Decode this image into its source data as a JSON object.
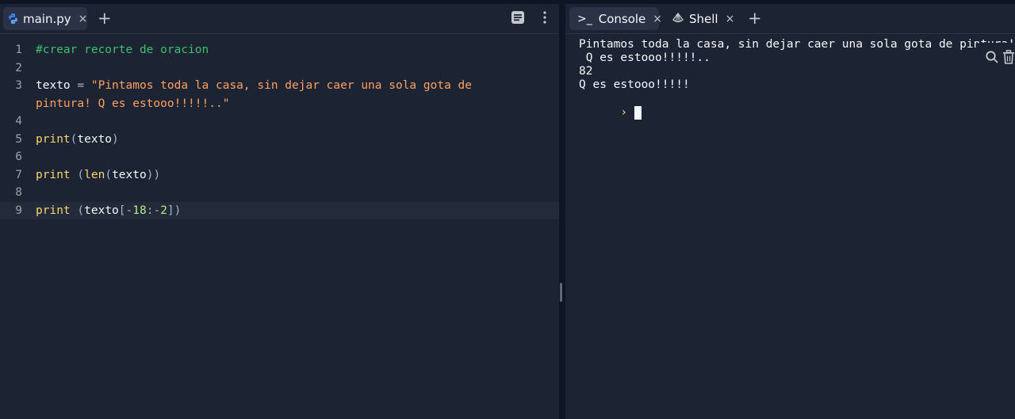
{
  "editor": {
    "tab": {
      "label": "main.py",
      "close": "×",
      "icon": "python-file-icon"
    },
    "new_tab": "+",
    "lines": [
      {
        "n": "1",
        "tokens": [
          {
            "t": "#crear recorte de oracion",
            "k": "comment"
          }
        ]
      },
      {
        "n": "2",
        "tokens": []
      },
      {
        "n": "3",
        "tokens": [
          {
            "t": "texto",
            "k": "ident"
          },
          {
            "t": " = ",
            "k": "op"
          },
          {
            "t": "\"Pintamos toda la casa, sin dejar caer una sola gota de",
            "k": "str"
          }
        ]
      },
      {
        "n": "",
        "tokens": [
          {
            "t": "pintura! Q es estooo!!!!!..\"",
            "k": "str"
          }
        ]
      },
      {
        "n": "4",
        "tokens": []
      },
      {
        "n": "5",
        "tokens": [
          {
            "t": "print",
            "k": "fn"
          },
          {
            "t": "(",
            "k": "op"
          },
          {
            "t": "texto",
            "k": "ident"
          },
          {
            "t": ")",
            "k": "op"
          }
        ]
      },
      {
        "n": "6",
        "tokens": []
      },
      {
        "n": "7",
        "tokens": [
          {
            "t": "print",
            "k": "fn"
          },
          {
            "t": " (",
            "k": "op"
          },
          {
            "t": "len",
            "k": "fn"
          },
          {
            "t": "(",
            "k": "op"
          },
          {
            "t": "texto",
            "k": "ident"
          },
          {
            "t": "))",
            "k": "op"
          }
        ]
      },
      {
        "n": "8",
        "tokens": []
      },
      {
        "n": "9",
        "current": true,
        "tokens": [
          {
            "t": "print",
            "k": "fn"
          },
          {
            "t": " (",
            "k": "op"
          },
          {
            "t": "texto",
            "k": "ident"
          },
          {
            "t": "[-",
            "k": "op"
          },
          {
            "t": "18",
            "k": "num"
          },
          {
            "t": ":-",
            "k": "op"
          },
          {
            "t": "2",
            "k": "num"
          },
          {
            "t": "])",
            "k": "op"
          }
        ]
      }
    ]
  },
  "console": {
    "tabs": [
      {
        "label": "Console",
        "prefix": ">_",
        "close": "×",
        "active": true
      },
      {
        "label": "Shell",
        "close": "×",
        "icon": "shell-icon"
      }
    ],
    "new_tab": "+",
    "output": [
      "Pintamos toda la casa, sin dejar caer una sola gota de pintura!",
      " Q es estooo!!!!!..",
      "82",
      "Q es estooo!!!!!"
    ],
    "prompt": "›"
  },
  "colors": {
    "background": "#0e1525",
    "panel": "#1c2333",
    "comment": "#3fbf6f",
    "string": "#ffa061",
    "function": "#f6d669",
    "number": "#b8e883"
  }
}
